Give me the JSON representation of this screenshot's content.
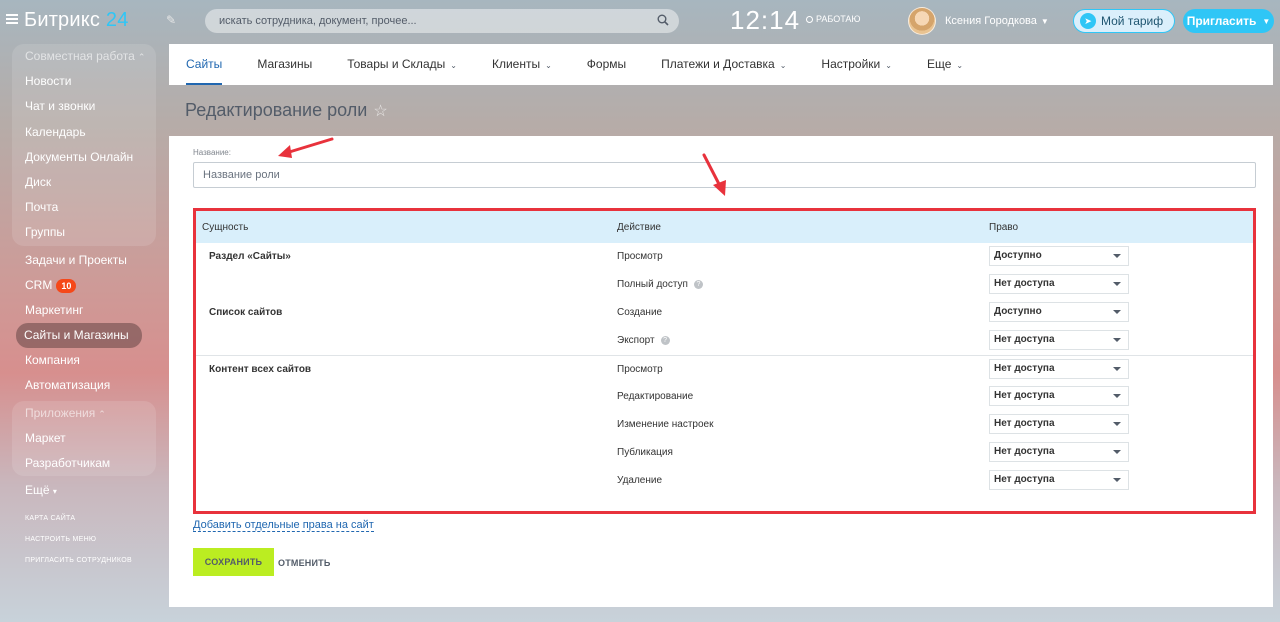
{
  "header": {
    "logo_text": "Битрикс",
    "logo_num": "24",
    "search_placeholder": "искать сотрудника, документ, прочее...",
    "clock": "12:14",
    "work_status": "РАБОТАЮ",
    "user_name": "Ксения Городкова",
    "tariff_label": "Мой тариф",
    "invite_label": "Пригласить",
    "accent_color": "#2fc6f6"
  },
  "sidebar": {
    "group1_title": "Совместная работа",
    "group1_items": [
      "Новости",
      "Чат и звонки",
      "Календарь",
      "Документы Онлайн",
      "Диск",
      "Почта",
      "Группы"
    ],
    "items": [
      "Задачи и Проекты",
      "CRM",
      "Маркетинг",
      "Сайты и Магазины",
      "Компания",
      "Автоматизация"
    ],
    "crm_badge": "10",
    "group2_title": "Приложения",
    "group2_items": [
      "Маркет",
      "Разработчикам"
    ],
    "more": "Ещё",
    "bottom_links": [
      "КАРТА САЙТА",
      "НАСТРОИТЬ МЕНЮ",
      "ПРИГЛАСИТЬ СОТРУДНИКОВ"
    ]
  },
  "tabs": [
    {
      "label": "Сайты",
      "active": true,
      "dropdown": false
    },
    {
      "label": "Магазины",
      "active": false,
      "dropdown": false
    },
    {
      "label": "Товары и Склады",
      "active": false,
      "dropdown": true
    },
    {
      "label": "Клиенты",
      "active": false,
      "dropdown": true
    },
    {
      "label": "Формы",
      "active": false,
      "dropdown": false
    },
    {
      "label": "Платежи и Доставка",
      "active": false,
      "dropdown": true
    },
    {
      "label": "Настройки",
      "active": false,
      "dropdown": true
    },
    {
      "label": "Еще",
      "active": false,
      "dropdown": true
    }
  ],
  "page": {
    "title": "Редактирование роли",
    "name_label": "Название:",
    "name_placeholder": "Название роли",
    "name_value": ""
  },
  "rights_table": {
    "headers": {
      "entity": "Сущность",
      "action": "Действие",
      "right": "Право"
    },
    "rows": [
      {
        "entity": "Раздел «Сайты»",
        "action": "Просмотр",
        "right": "Доступно",
        "help": false,
        "sep": false
      },
      {
        "entity": "",
        "action": "Полный доступ",
        "right": "Нет доступа",
        "help": true,
        "sep": false
      },
      {
        "entity": "Список сайтов",
        "action": "Создание",
        "right": "Доступно",
        "help": false,
        "sep": false
      },
      {
        "entity": "",
        "action": "Экспорт",
        "right": "Нет доступа",
        "help": true,
        "sep": false
      },
      {
        "entity": "Контент всех сайтов",
        "action": "Просмотр",
        "right": "Нет доступа",
        "help": false,
        "sep": true
      },
      {
        "entity": "",
        "action": "Редактирование",
        "right": "Нет доступа",
        "help": false,
        "sep": false
      },
      {
        "entity": "",
        "action": "Изменение настроек",
        "right": "Нет доступа",
        "help": false,
        "sep": false
      },
      {
        "entity": "",
        "action": "Публикация",
        "right": "Нет доступа",
        "help": false,
        "sep": false
      },
      {
        "entity": "",
        "action": "Удаление",
        "right": "Нет доступа",
        "help": false,
        "sep": false
      }
    ]
  },
  "actions": {
    "add_link": "Добавить отдельные права на сайт",
    "save": "СОХРАНИТЬ",
    "cancel": "ОТМЕНИТЬ"
  },
  "annotation_color": "#e8323c"
}
